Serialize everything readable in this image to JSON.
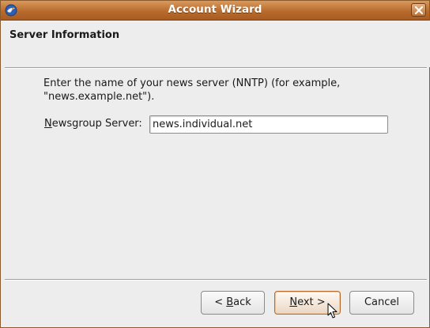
{
  "window": {
    "title": "Account Wizard"
  },
  "page": {
    "title": "Server Information",
    "description": "Enter the name of your news server (NNTP) (for example, \"news.example.net\")."
  },
  "form": {
    "server_label_mnemonic": "N",
    "server_label_rest": "ewsgroup Server:",
    "server_value": "news.individual.net"
  },
  "buttons": {
    "back_prefix": "< ",
    "back_mnemonic": "B",
    "back_rest": "ack",
    "next_mnemonic": "N",
    "next_rest": "ext >",
    "cancel": "Cancel"
  },
  "icons": {
    "app": "thunderbird-icon",
    "close": "close-icon",
    "cursor": "mouse-pointer-icon"
  },
  "colors": {
    "titlebar": "#b96b2c",
    "background": "#ededed",
    "default_button_border": "#b86a2c"
  }
}
